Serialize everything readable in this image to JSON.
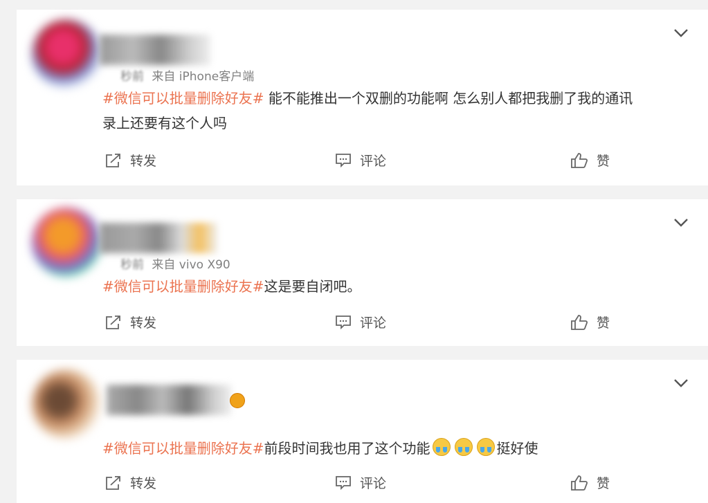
{
  "comments": [
    {
      "time_blurred": "秒前",
      "source": "来自 iPhone客户端",
      "hashtag": "#微信可以批量删除好友#",
      "text_line1": " 能不能推出一个双删的功能啊 怎么别人都把我删了我的通讯",
      "text_line2": "录上还要有这个人吗",
      "avatar_colors": [
        "#e8306a",
        "#b81f2f",
        "#7c8fd0",
        "#333333"
      ]
    },
    {
      "time_blurred": "秒前",
      "source": "来自 vivo X90",
      "hashtag": "#微信可以批量删除好友#",
      "text_line1": "这是要自闭吧。",
      "avatar_colors": [
        "#f39a2a",
        "#e85a6f",
        "#7d6fd0",
        "#5ac8a8"
      ]
    },
    {
      "hashtag": "#微信可以批量删除好友#",
      "text_line1": "前段时间我也用了这个功能",
      "text_after_emoji": "挺好使",
      "avatar_colors": [
        "#6b4a35",
        "#c48a62",
        "#3a3a3a",
        "#e8c9a8"
      ]
    }
  ],
  "actions": {
    "repost": "转发",
    "comment": "评论",
    "like": "赞"
  },
  "icons": {
    "repost": "share-arrow-icon",
    "comment": "comment-bubble-icon",
    "like": "thumbs-up-icon",
    "more": "chevron-down-icon",
    "emoji": "crying-face-emoji-icon"
  },
  "colors": {
    "hashtag": "#eb7350",
    "text": "#333333",
    "meta": "#808080",
    "background": "#f2f2f2"
  }
}
